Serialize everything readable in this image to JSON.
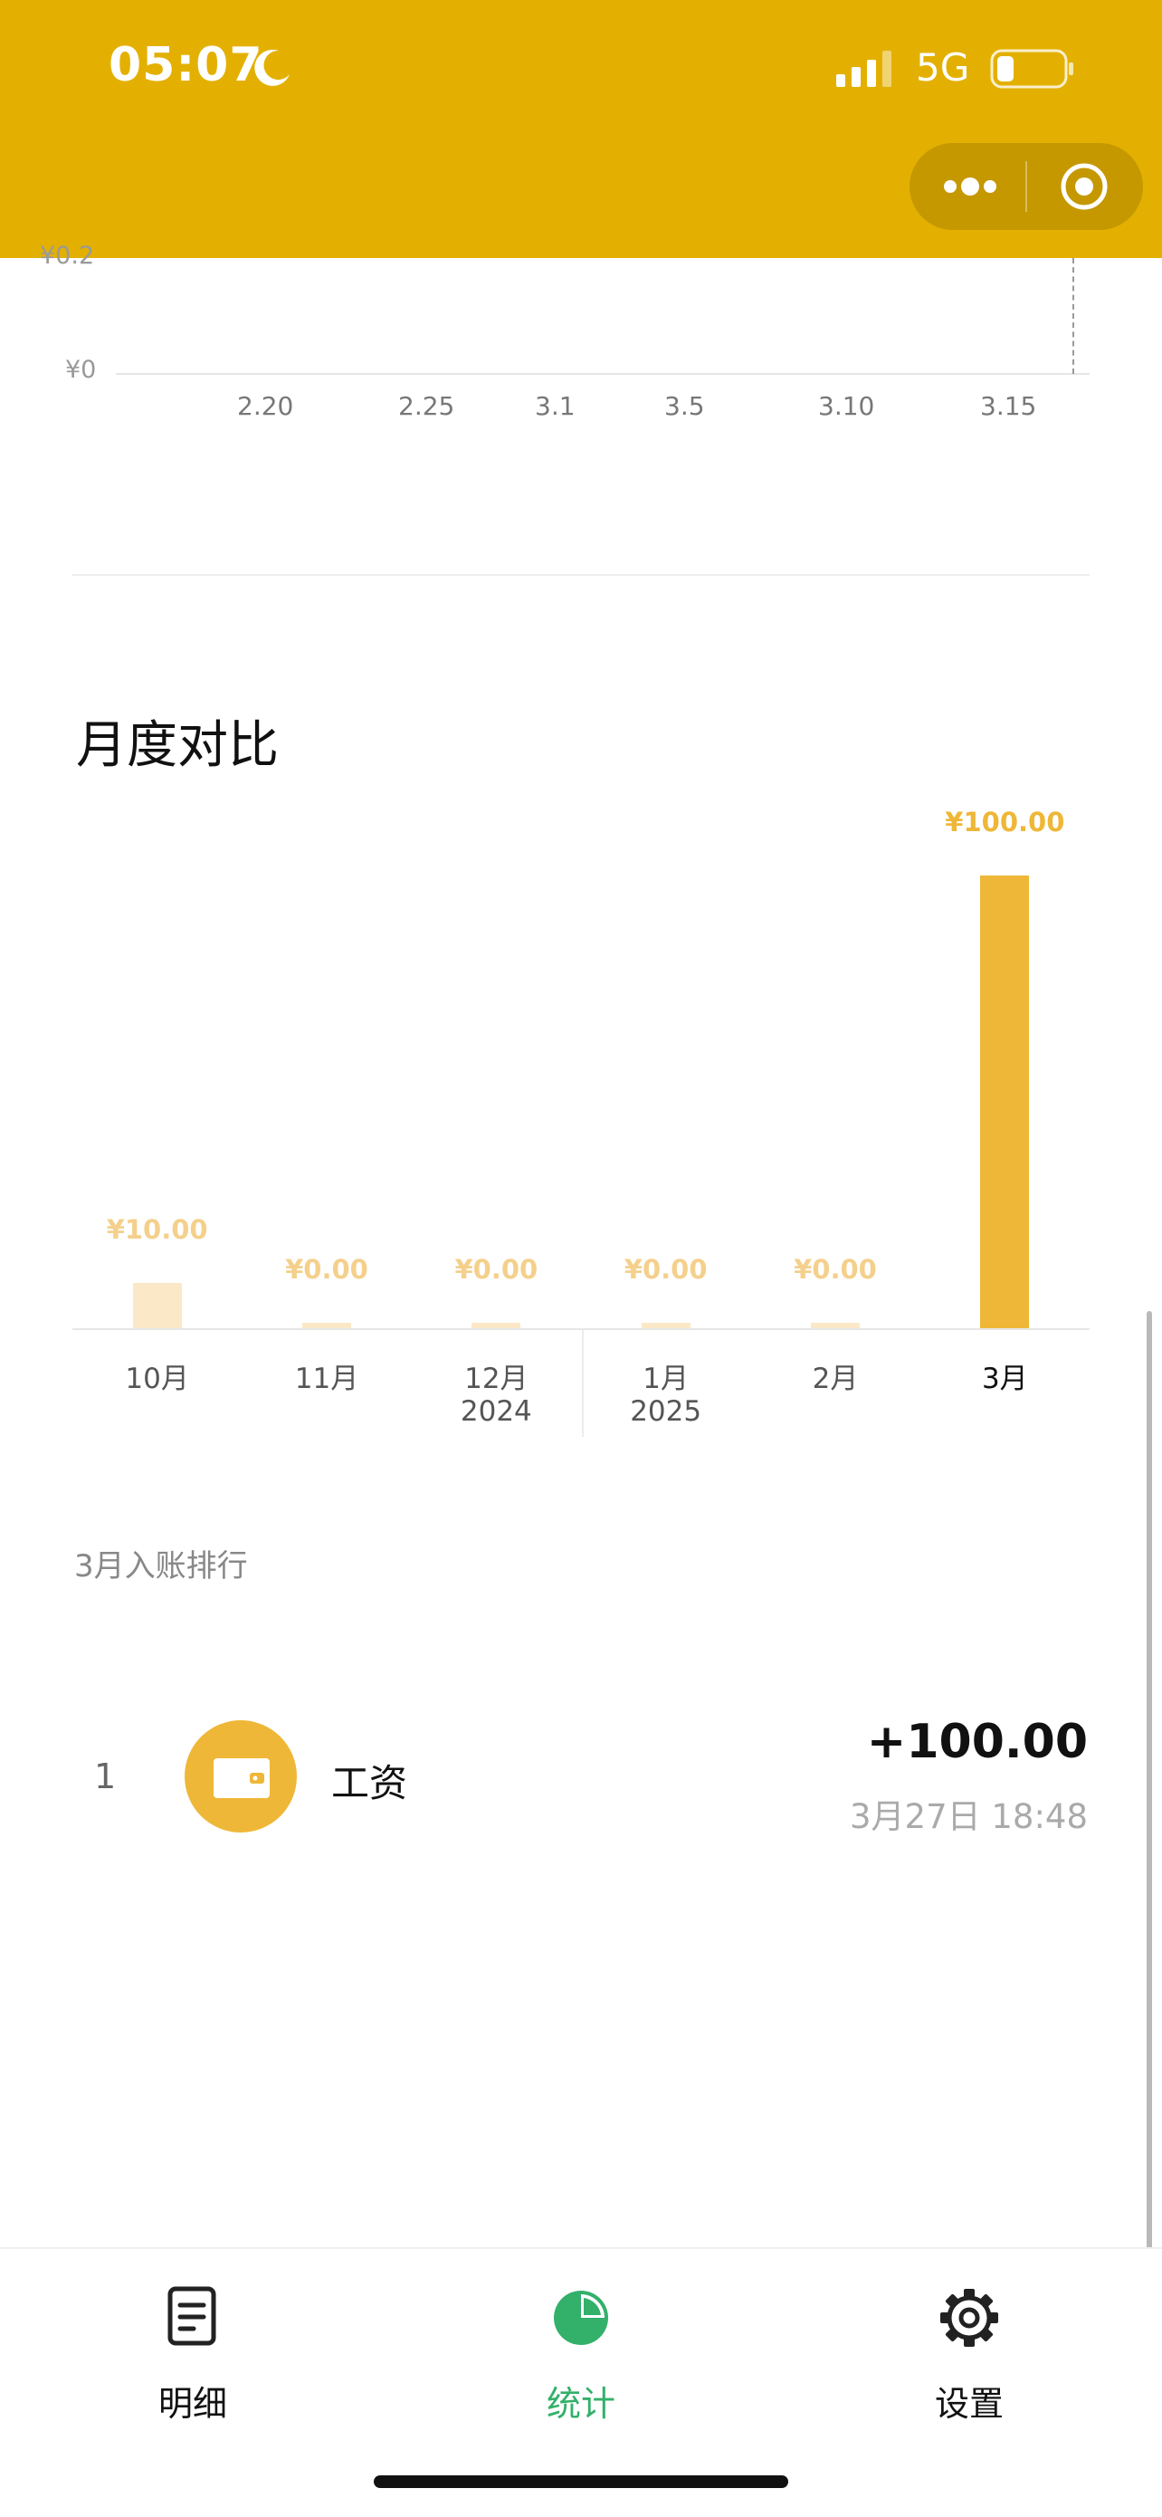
{
  "status_bar": {
    "time": "05:07",
    "network": "5G"
  },
  "colors": {
    "header": "#e3b001",
    "accent_bar": "#efb737",
    "bar_faded": "#fbe8c6",
    "value_faded": "#f4d08c",
    "active_tab": "#33b06a"
  },
  "trend_chart": {
    "y_labels": [
      "¥0.2",
      "¥0"
    ],
    "x_labels": [
      "2.20",
      "2.25",
      "3.1",
      "3.5",
      "3.10",
      "3.15"
    ]
  },
  "monthly": {
    "title": "月度对比",
    "bars": [
      {
        "month": "10月",
        "year": "",
        "value": 10,
        "label": "¥10.00",
        "active": false
      },
      {
        "month": "11月",
        "year": "",
        "value": 0,
        "label": "¥0.00",
        "active": false
      },
      {
        "month": "12月",
        "year": "2024",
        "value": 0,
        "label": "¥0.00",
        "active": false
      },
      {
        "month": "1月",
        "year": "2025",
        "value": 0,
        "label": "¥0.00",
        "active": false
      },
      {
        "month": "2月",
        "year": "",
        "value": 0,
        "label": "¥0.00",
        "active": false
      },
      {
        "month": "3月",
        "year": "",
        "value": 100,
        "label": "¥100.00",
        "active": true
      }
    ]
  },
  "ranking": {
    "title": "3月入账排行",
    "items": [
      {
        "rank": "1",
        "icon": "wallet-icon",
        "name": "工资",
        "amount": "+100.00",
        "time": "3月27日 18:48"
      }
    ]
  },
  "tabs": [
    {
      "label": "明细",
      "icon": "document-icon",
      "active": false
    },
    {
      "label": "统计",
      "icon": "pie-chart-icon",
      "active": true
    },
    {
      "label": "设置",
      "icon": "gear-icon",
      "active": false
    }
  ]
}
